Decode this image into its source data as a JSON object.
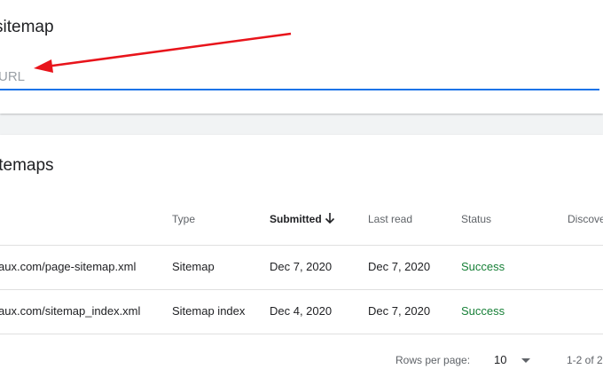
{
  "add_sitemap": {
    "title": "sitemap",
    "input_placeholder": "URL",
    "input_value": ""
  },
  "sitemaps": {
    "title": "itemaps",
    "columns": [
      "Type",
      "Submitted",
      "Last read",
      "Status",
      "Discove"
    ],
    "sorted_column": "Submitted",
    "rows": [
      {
        "url": "aux.com/page-sitemap.xml",
        "type": "Sitemap",
        "submitted": "Dec 7, 2020",
        "last_read": "Dec 7, 2020",
        "status": "Success"
      },
      {
        "url": "aux.com/sitemap_index.xml",
        "type": "Sitemap index",
        "submitted": "Dec 4, 2020",
        "last_read": "Dec 7, 2020",
        "status": "Success"
      }
    ]
  },
  "pagination": {
    "rows_per_page_label": "Rows per page:",
    "rows_per_page_value": "10",
    "range": "1-2 of 2"
  },
  "colors": {
    "accent": "#1a73e8",
    "success": "#188038",
    "annotation_arrow": "#e8141b"
  },
  "icons": {
    "sort": "arrow-down-icon",
    "dropdown": "caret-down-icon"
  }
}
